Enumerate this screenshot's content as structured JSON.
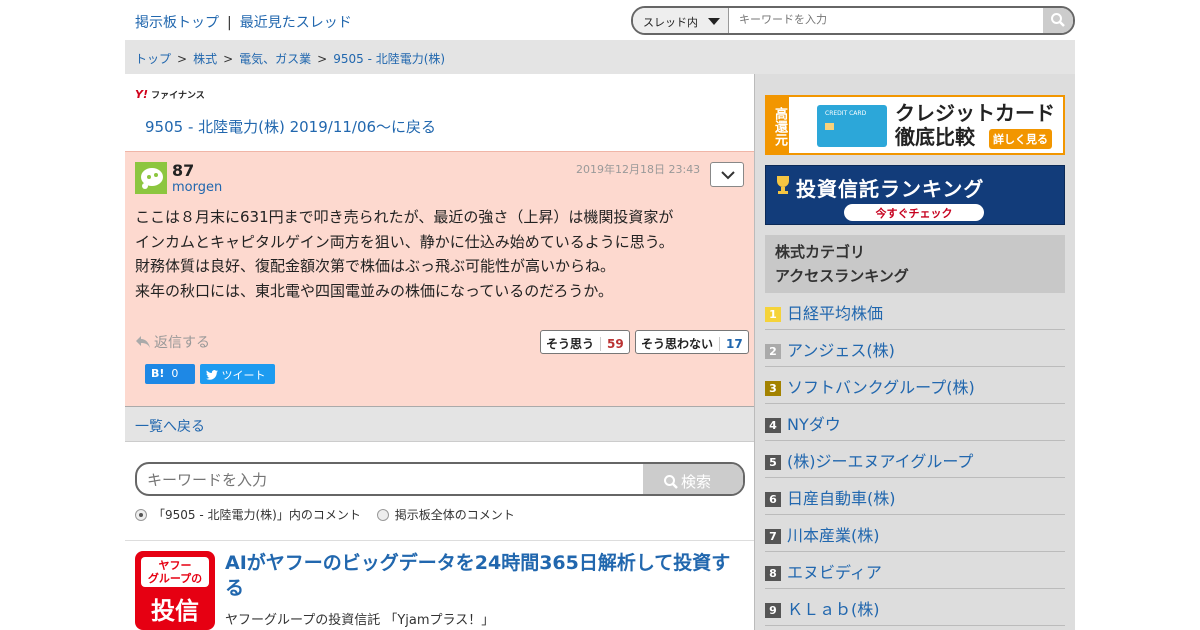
{
  "header": {
    "link_top": "掲示板トップ",
    "separator": "|",
    "link_recent": "最近見たスレッド",
    "search_scope": "スレッド内",
    "search_placeholder": "キーワードを入力"
  },
  "breadcrumb": [
    "トップ",
    "株式",
    "電気、ガス業",
    "9505 - 北陸電力(株)"
  ],
  "breadcrumb_sep": ">",
  "main": {
    "logo_text": "ファイナンス",
    "logo_y": "Y!",
    "back_thread": "9505 - 北陸電力(株) 2019/11/06〜に戻る",
    "post": {
      "number": "87",
      "author": "morgen",
      "date": "2019年12月18日 23:43",
      "lines": [
        "ここは８月末に631円まで叩き売られたが、最近の強さ（上昇）は機関投資家が",
        "インカムとキャピタルゲイン両方を狙い、静かに仕込み始めているように思う。",
        "財務体質は良好、復配金額次第で株価はぶっ飛ぶ可能性が高いからね。",
        "来年の秋口には、東北電や四国電並みの株価になっているのだろうか。"
      ],
      "reply_label": "返信する",
      "agree_label": "そう思う",
      "agree_count": "59",
      "disagree_label": "そう思わない",
      "disagree_count": "17",
      "hatena_label": "B!",
      "hatena_count": "0",
      "tweet_label": "ツイート"
    },
    "back_list": "一覧へ戻る",
    "search": {
      "placeholder": "キーワードを入力",
      "button": "検索",
      "option_thread": "「9505 - 北陸電力(株)」内のコメント",
      "option_all": "掲示板全体のコメント"
    },
    "ad": {
      "logo_line1": "ヤフー",
      "logo_line2": "グループの",
      "logo_line3": "投信",
      "title": "AIがヤフーのビッグデータを24時間365日解析して投資する",
      "subtitle": "ヤフーグループの投資信託 「Yjamプラス！」"
    }
  },
  "sidebar": {
    "banner1": {
      "tag": "高還元",
      "card_text": "CREDIT CARD",
      "title_line1": "クレジットカード",
      "title_line2": "徹底比較",
      "more": "詳しく見る"
    },
    "banner2": {
      "title": "投資信託ランキング",
      "button": "今すぐチェック"
    },
    "ranking_title_line1": "株式カテゴリ",
    "ranking_title_line2": "アクセスランキング",
    "ranking": [
      {
        "rank": "1",
        "name": "日経平均株価"
      },
      {
        "rank": "2",
        "name": "アンジェス(株)"
      },
      {
        "rank": "3",
        "name": "ソフトバンクグループ(株)"
      },
      {
        "rank": "4",
        "name": "NYダウ"
      },
      {
        "rank": "5",
        "name": "(株)ジーエヌアイグループ"
      },
      {
        "rank": "6",
        "name": "日産自動車(株)"
      },
      {
        "rank": "7",
        "name": "川本産業(株)"
      },
      {
        "rank": "8",
        "name": "エヌビディア"
      },
      {
        "rank": "9",
        "name": "ＫＬａｂ(株)"
      }
    ]
  }
}
